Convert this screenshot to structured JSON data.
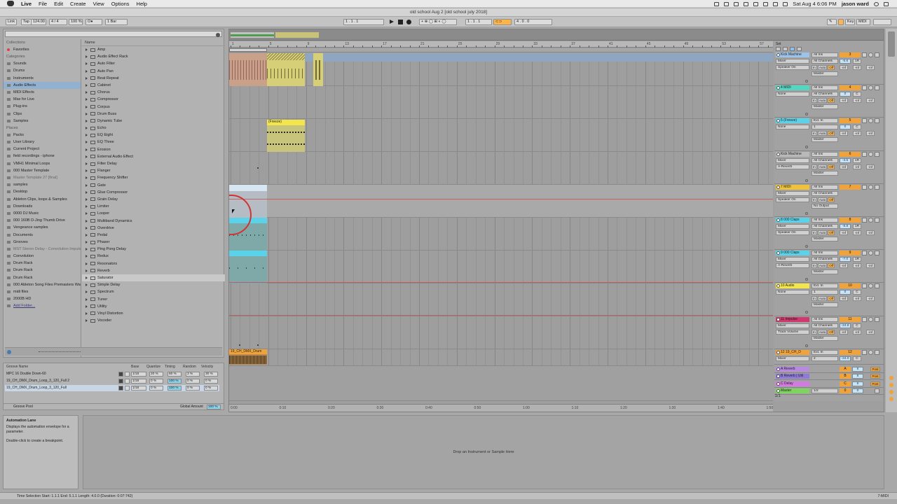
{
  "menubar": {
    "app": "Live",
    "menus": [
      "File",
      "Edit",
      "Create",
      "View",
      "Options",
      "Help"
    ],
    "datetime": "Sat Aug 4  6:06 PM",
    "user": "jason ward"
  },
  "window": {
    "title": "old school Aug 2  [old school july 2018]"
  },
  "control": {
    "link": "Link",
    "tap": "Tap",
    "tempo": "124.00",
    "sig_num": "4",
    "sig_den": "4",
    "zoom": "100 %",
    "metronome": "O●",
    "quantize": "1 Bar",
    "arr_position": "1 .  1 .  1",
    "loop_start": "1 .  1 .  1",
    "loop_length": "4 .  0 .  0",
    "key": "Key",
    "midi": "MIDI"
  },
  "browser": {
    "collections_head": "Collections",
    "favorites": "Favorites",
    "categories_head": "Categories",
    "categories": [
      "Sounds",
      "Drums",
      "Instruments",
      "Audio Effects",
      "MIDI Effects",
      "Max for Live",
      "Plug-ins",
      "Clips",
      "Samples"
    ],
    "places_head": "Places",
    "places": [
      "Packs",
      "User Library",
      "Current Project",
      "field recordings - iphone",
      "VMH1 Minimal Loops",
      "000 Master Template",
      "Master Template 27 [final]",
      "samples",
      "Desktop",
      "Ableton Clips, loops & Samples",
      "Downloads",
      "0000 DJ Music",
      "000 160B D-Jing Thumb Drive",
      "Vengeance samples",
      "Documents",
      "Grooves",
      "MST Stereo Delay - Convolution Impulse",
      "Convolution",
      "Drum Rack",
      "Drum Rack",
      "Drum Rack",
      "000 Ableton Song Files Premasters Wav",
      "midi files",
      "2000B HD",
      "Add Folder..."
    ],
    "content_head": "Name",
    "items": [
      "Amp",
      "Audio Effect Rack",
      "Auto Filter",
      "Auto Pan",
      "Beat Repeat",
      "Cabinet",
      "Chorus",
      "Compressor",
      "Corpus",
      "Drum Buss",
      "Dynamic Tube",
      "Echo",
      "EQ Eight",
      "EQ Three",
      "Erosion",
      "External Audio Effect",
      "Filter Delay",
      "Flanger",
      "Frequency Shifter",
      "Gate",
      "Glue Compressor",
      "Grain Delay",
      "Limiter",
      "Looper",
      "Multiband Dynamics",
      "Overdrive",
      "Pedal",
      "Phaser",
      "Ping Pong Delay",
      "Redux",
      "Resonators",
      "Reverb",
      "Saturator",
      "Simple Delay",
      "Spectrum",
      "Tuner",
      "Utility",
      "Vinyl Distortion",
      "Vocoder"
    ]
  },
  "groove": {
    "headers": [
      "Groove Name",
      "Base",
      "Quantize",
      "Timing",
      "Random",
      "Velocity"
    ],
    "rows": [
      {
        "name": "MPC 16 Double Down-60",
        "base": "1/16",
        "quantize": "20 %",
        "timing": "60 %",
        "random": "3 %",
        "velocity": "30 %"
      },
      {
        "name": "19_CH_DMX_Drum_Loop_3_120_Full 2",
        "base": "1/16",
        "quantize": "0 %",
        "timing": "100 %",
        "random": "0 %",
        "velocity": "0 %"
      },
      {
        "name": "19_CH_DMX_Drum_Loop_3_120_Full",
        "base": "1/16",
        "quantize": "0 %",
        "timing": "100 %",
        "random": "0 %",
        "velocity": "0 %"
      }
    ],
    "footer": "Groove Pool",
    "global_label": "Global Amount",
    "global_value": "100 %"
  },
  "ruler": [
    "1",
    "5",
    "9",
    "13",
    "17",
    "21",
    "25",
    "29",
    "33",
    "37",
    "41",
    "45",
    "49",
    "53",
    "57"
  ],
  "timeline": [
    "0:00",
    "0:10",
    "0:20",
    "0:30",
    "0:40",
    "0:50",
    "1:00",
    "1:10",
    "1:20",
    "1:30",
    "1:40",
    "1:50"
  ],
  "clips": [
    {
      "label": "(Freeze)"
    },
    {
      "label": "19_CH_DMX_Drum"
    }
  ],
  "mixer": {
    "set": "Set",
    "count": "1/1",
    "tracks": [
      {
        "name": "Kick Machine",
        "color": "#9ec3ea",
        "dev1": "Mixer",
        "dev2": "Speaker On",
        "io1": "All Ins",
        "io2": "All Channels",
        "io3": "Master",
        "num": "3",
        "vol": "-5.6",
        "pan": "1R"
      },
      {
        "name": "4 MIDI",
        "color": "#53d6c2",
        "dev1": "None",
        "dev2": "",
        "io1": "All Ins",
        "io2": "All Channels",
        "io3": "Master",
        "num": "4",
        "vol": "0",
        "pan": "C"
      },
      {
        "name": "5  (Freeze)",
        "color": "#5ad3ea",
        "dev1": "None",
        "dev2": "",
        "io1": "Ext. In",
        "io2": "1",
        "io3": "Master",
        "num": "5",
        "vol": "0",
        "pan": "C"
      },
      {
        "name": "Kick Machine",
        "color": "#b9b9b9",
        "dev1": "Mixer",
        "dev2": "A-Reverb",
        "io1": "All Ins",
        "io2": "All Channels",
        "io3": "Master",
        "num": "6",
        "vol": "-3.5",
        "pan": "1R"
      },
      {
        "name": "7 MIDI",
        "color": "#f0c23a",
        "dev1": "Mixer",
        "dev2": "Speaker On",
        "io1": "All Ins",
        "io2": "All Channels",
        "io3": "No Output",
        "num": "7",
        "vol": "",
        "pan": ""
      },
      {
        "name": "8 000 Claps",
        "color": "#5ad3ea",
        "dev1": "Mixer",
        "dev2": "Speaker On",
        "io1": "All Ins",
        "io2": "All Channels",
        "io3": "Master",
        "num": "8",
        "vol": "-8.8",
        "pan": "1R"
      },
      {
        "name": "9 000 Claps",
        "color": "#5ad3ea",
        "dev1": "Mixer",
        "dev2": "A-Reverb",
        "io1": "All Ins",
        "io2": "All Channels",
        "io3": "Master",
        "num": "9",
        "vol": "-7.0",
        "pan": "1R"
      },
      {
        "name": "10 Audio",
        "color": "#f3e54a",
        "dev1": "None",
        "dev2": "",
        "io1": "Ext. In",
        "io2": "1",
        "io3": "Master",
        "num": "10",
        "vol": "0",
        "pan": "C"
      },
      {
        "name": "11 Impulse",
        "color": "#d1386d",
        "dev1": "Mixer",
        "dev2": "Track Volume",
        "io1": "All Ins",
        "io2": "All Channels",
        "io3": "Master",
        "num": "11",
        "vol": "-24.6",
        "pan": "C"
      },
      {
        "name": "12 19_CH_D",
        "color": "#f0a33a",
        "dev1": "Mixer",
        "dev2": "",
        "io1": "Ext. In",
        "io2": "2",
        "io3": "",
        "num": "12",
        "vol": "-24.0",
        "pan": "C"
      }
    ],
    "returns": [
      {
        "name": "A Reverb",
        "color": "#b78ae0",
        "num": "A",
        "vol": "6"
      },
      {
        "name": "B Reverb | Util",
        "color": "#8f7ad8",
        "num": "B",
        "vol": "6"
      },
      {
        "name": "C Delay",
        "color": "#d27adf",
        "num": "C",
        "vol": "6"
      },
      {
        "name": "Master",
        "color": "#7fd35f",
        "io": "1/2",
        "num": "0",
        "vol": "0"
      }
    ],
    "monitor": [
      "In",
      "Auto",
      "Off"
    ],
    "inf": "-inf",
    "post": "Post"
  },
  "info": {
    "title": "Automation Lane",
    "line1": "Displays the automation envelope for a parameter.",
    "line2": "Double-click to create a breakpoint."
  },
  "detail": {
    "drop": "Drop an Instrument or Sample Here"
  },
  "status": {
    "text": "Time Selection   Start: 1.1.1     End: 5.1.1     Length: 4.0.0  (Duration: 0:07:742)",
    "track": "7-MIDI"
  }
}
